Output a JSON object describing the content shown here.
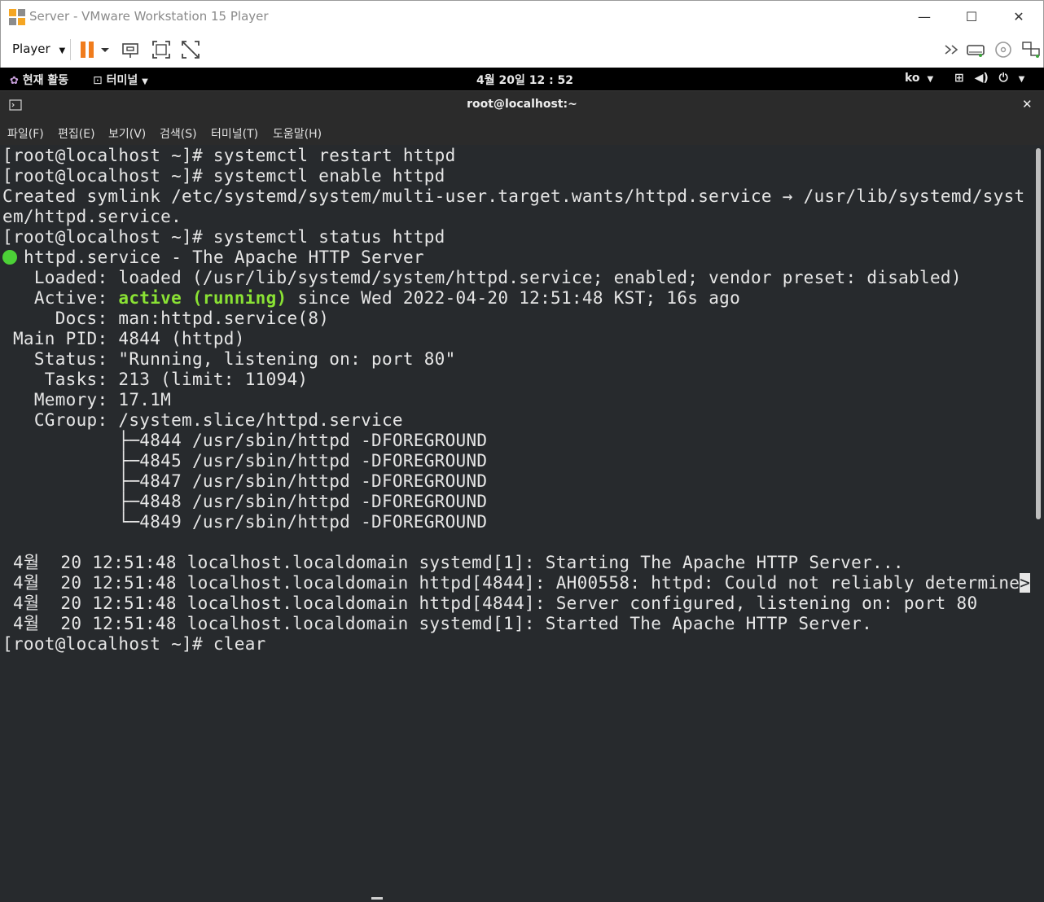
{
  "window": {
    "title": "Server - VMware Workstation 15 Player",
    "minimize_glyph": "—",
    "maximize_glyph": "☐",
    "close_glyph": "✕"
  },
  "toolbar": {
    "player_label": "Player",
    "icons": [
      "pause-icon",
      "send-ctrl-alt-del-icon",
      "fit-guest-icon",
      "unity-icon",
      "more-icon",
      "hard-disk-icon",
      "cd-icon",
      "network-icon"
    ],
    "pause_color": "#f07c1d"
  },
  "gnome": {
    "activities": "현재 활동",
    "terminal_app": "터미널",
    "clock": "4월 20일  12 : 52",
    "input_lang": "ko"
  },
  "terminal": {
    "title": "root@localhost:~",
    "menu": [
      "파일(F)",
      "편집(E)",
      "보기(V)",
      "검색(S)",
      "터미널(T)",
      "도움말(H)"
    ],
    "lines": [
      "[root@localhost ~]# systemctl restart httpd",
      "[root@localhost ~]# systemctl enable httpd",
      "Created symlink /etc/systemd/system/multi-user.target.wants/httpd.service → /usr/lib/systemd/syst",
      "em/httpd.service.",
      "[root@localhost ~]# systemctl status httpd",
      "httpd.service - The Apache HTTP Server",
      "   Loaded: loaded (/usr/lib/systemd/system/httpd.service; enabled; vendor preset: disabled)",
      "   Active: ",
      "active (running)",
      " since Wed 2022-04-20 12:51:48 KST; 16s ago",
      "     Docs: man:httpd.service(8)",
      " Main PID: 4844 (httpd)",
      "   Status: \"Running, listening on: port 80\"",
      "    Tasks: 213 (limit: 11094)",
      "   Memory: 17.1M",
      "   CGroup: /system.slice/httpd.service",
      "           ├─4844 /usr/sbin/httpd -DFOREGROUND",
      "           ├─4845 /usr/sbin/httpd -DFOREGROUND",
      "           ├─4847 /usr/sbin/httpd -DFOREGROUND",
      "           ├─4848 /usr/sbin/httpd -DFOREGROUND",
      "           └─4849 /usr/sbin/httpd -DFOREGROUND",
      "",
      " 4월  20 12:51:48 localhost.localdomain systemd[1]: Starting The Apache HTTP Server...",
      " 4월  20 12:51:48 localhost.localdomain httpd[4844]: AH00558: httpd: Could not reliably determine",
      ">",
      " 4월  20 12:51:48 localhost.localdomain httpd[4844]: Server configured, listening on: port 80",
      " 4월  20 12:51:48 localhost.localdomain systemd[1]: Started The Apache HTTP Server.",
      "[root@localhost ~]# clear"
    ],
    "status_dot_color": "#4cd137",
    "active_color": "#8ae234"
  }
}
